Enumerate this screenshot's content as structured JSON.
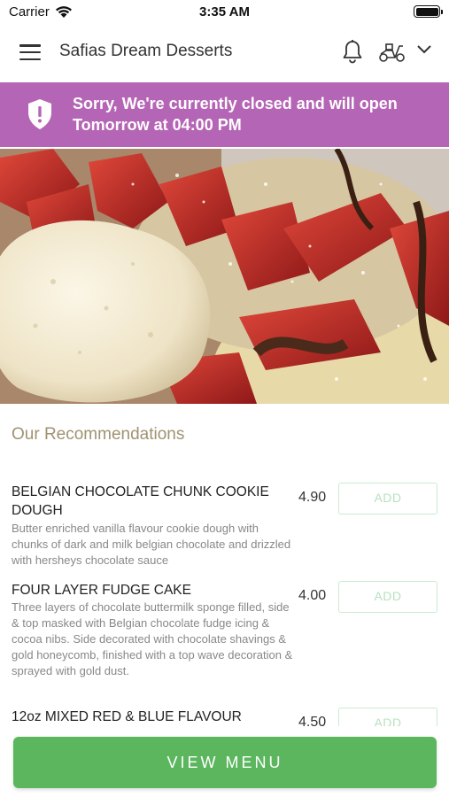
{
  "status_bar": {
    "carrier": "Carrier",
    "time": "3:35 AM"
  },
  "header": {
    "title": "Safias Dream Desserts",
    "icons": [
      "menu-icon",
      "bell-icon",
      "scooter-icon",
      "chevron-down-icon"
    ]
  },
  "banner": {
    "message": "Sorry, We're currently closed and will open Tomorrow at 04:00 PM",
    "color": "#b565b5",
    "icon": "shield-icon"
  },
  "recommendations": {
    "title": "Our Recommendations",
    "items": [
      {
        "name": "BELGIAN CHOCOLATE CHUNK COOKIE DOUGH",
        "description": "Butter enriched vanilla flavour cookie dough with chunks of dark and milk belgian chocolate and drizzled with  hersheys chocolate sauce",
        "price": "4.90",
        "button": "ADD"
      },
      {
        "name": "FOUR LAYER FUDGE CAKE",
        "description": "Three layers of chocolate buttermilk sponge filled, side & top masked with Belgian chocolate fudge icing & cocoa nibs. Side decorated with chocolate shavings & gold honeycomb, finished with a top wave decoration & sprayed with gold dust.",
        "price": "4.00",
        "button": "ADD"
      },
      {
        "name": "12oz MIXED RED & BLUE FLAVOUR",
        "description": "",
        "price": "4.50",
        "button": "ADD"
      }
    ]
  },
  "footer": {
    "view_menu": "VIEW MENU",
    "accent": "#5bb65e"
  }
}
